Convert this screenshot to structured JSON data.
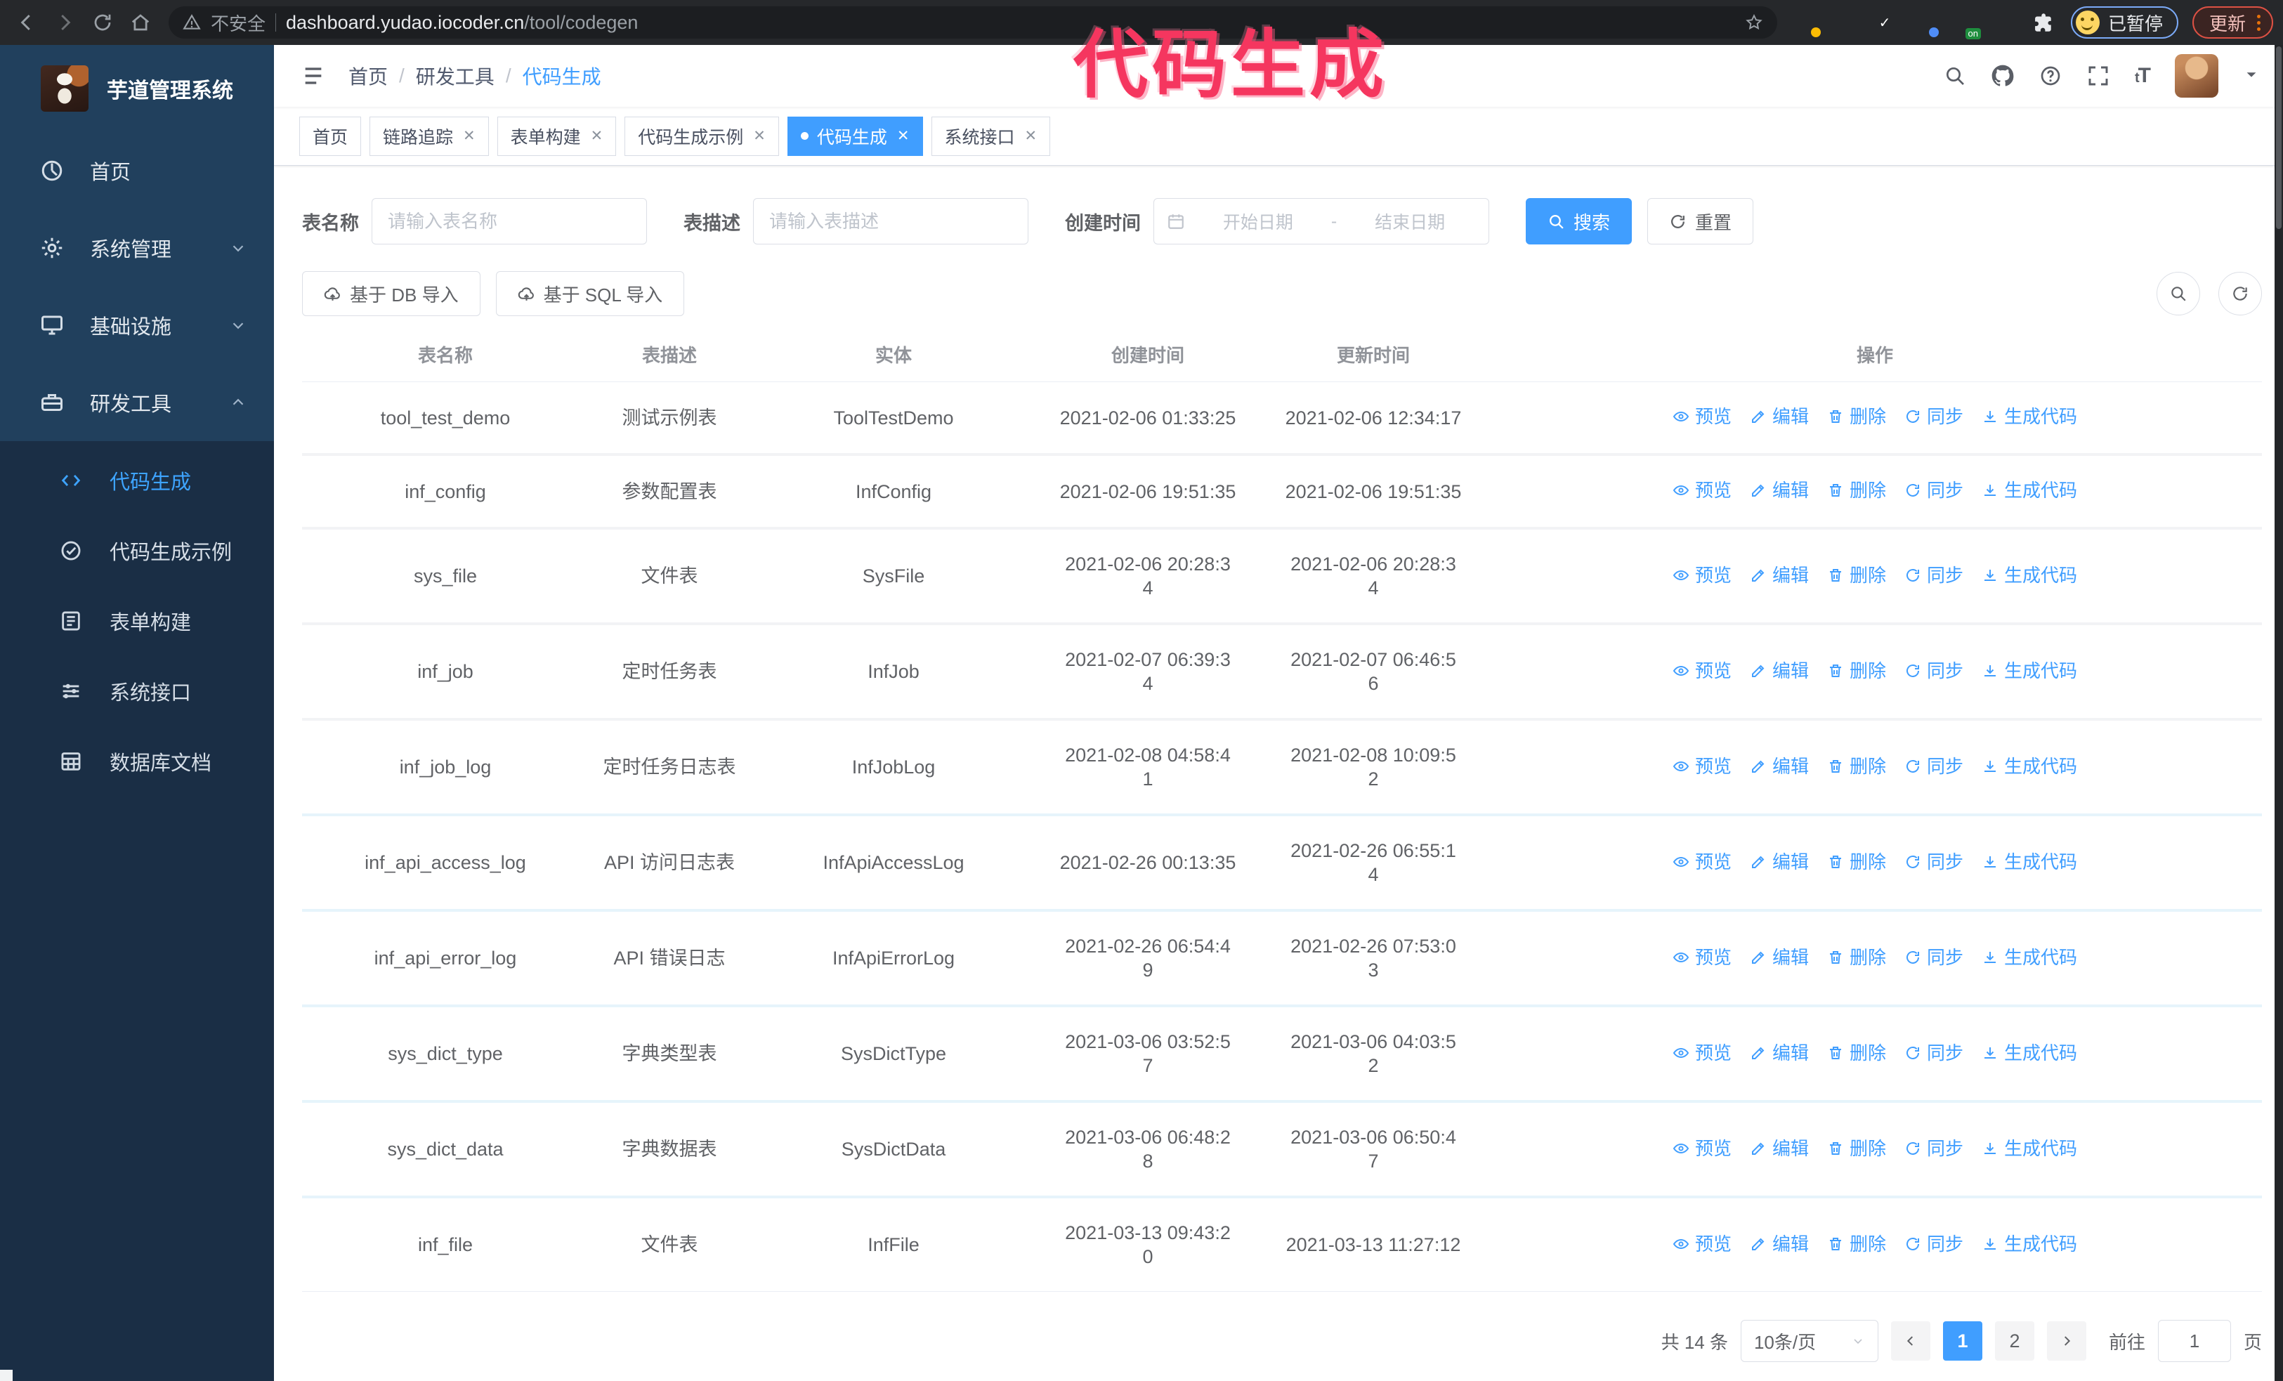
{
  "watermark": "代码生成",
  "browser": {
    "security_label": "不安全",
    "url_host": "dashboard.yudao.iocoder.cn",
    "url_path": "/tool/codegen",
    "profile_label": "已暂停",
    "update_label": "更新",
    "extensions": [
      {
        "name": "extension-orange-icon",
        "bg": "#e8710a",
        "shape": "circle",
        "badge": "#fbbc04"
      },
      {
        "name": "extension-gem-icon",
        "bg": "#4f8df7",
        "shape": "diamond"
      },
      {
        "name": "extension-green-check-icon",
        "bg": "#1e8e3e",
        "shape": "circle",
        "glyph": "✓"
      },
      {
        "name": "extension-grid-icon",
        "bg": "#9aa0a6",
        "shape": "square",
        "badge": "#4f8df7"
      },
      {
        "name": "extension-dark-on-icon",
        "bg": "#3c4043",
        "shape": "square",
        "badge_text": "on"
      },
      {
        "name": "extension-green-avatar-icon",
        "bg": "#8bc34a",
        "shape": "circle"
      },
      {
        "name": "extension-puzzle-icon",
        "shape": "puzzle"
      }
    ]
  },
  "sidebar": {
    "logo_title": "芋道管理系统",
    "top_items": [
      {
        "label": "首页",
        "icon": "dashboard-icon",
        "chevron": null,
        "active": false
      },
      {
        "label": "系统管理",
        "icon": "gear-icon",
        "chevron": "down",
        "active": false
      },
      {
        "label": "基础设施",
        "icon": "monitor-icon",
        "chevron": "down",
        "active": false
      },
      {
        "label": "研发工具",
        "icon": "toolbox-icon",
        "chevron": "up",
        "active": false
      }
    ],
    "sub_items": [
      {
        "label": "代码生成",
        "icon": "code-icon",
        "active": true
      },
      {
        "label": "代码生成示例",
        "icon": "example-icon",
        "active": false
      },
      {
        "label": "表单构建",
        "icon": "form-icon",
        "active": false
      },
      {
        "label": "系统接口",
        "icon": "api-icon",
        "active": false
      },
      {
        "label": "数据库文档",
        "icon": "database-icon",
        "active": false
      }
    ]
  },
  "header": {
    "breadcrumb": [
      "首页",
      "研发工具",
      "代码生成"
    ]
  },
  "tabs": [
    {
      "label": "首页",
      "closable": false,
      "active": false
    },
    {
      "label": "链路追踪",
      "closable": true,
      "active": false
    },
    {
      "label": "表单构建",
      "closable": true,
      "active": false
    },
    {
      "label": "代码生成示例",
      "closable": true,
      "active": false
    },
    {
      "label": "代码生成",
      "closable": true,
      "active": true
    },
    {
      "label": "系统接口",
      "closable": true,
      "active": false
    }
  ],
  "search_form": {
    "fields": [
      {
        "label": "表名称",
        "placeholder": "请输入表名称"
      },
      {
        "label": "表描述",
        "placeholder": "请输入表描述"
      },
      {
        "label": "创建时间",
        "start_placeholder": "开始日期",
        "separator": "-",
        "end_placeholder": "结束日期"
      }
    ],
    "search_label": "搜索",
    "reset_label": "重置"
  },
  "toolbar": {
    "import_db_label": "基于 DB 导入",
    "import_sql_label": "基于 SQL 导入"
  },
  "table": {
    "columns": [
      "表名称",
      "表描述",
      "实体",
      "创建时间",
      "更新时间",
      "操作"
    ],
    "ops": [
      {
        "label": "预览",
        "icon": "eye-icon"
      },
      {
        "label": "编辑",
        "icon": "edit-icon"
      },
      {
        "label": "删除",
        "icon": "delete-icon"
      },
      {
        "label": "同步",
        "icon": "sync-icon"
      },
      {
        "label": "生成代码",
        "icon": "download-icon"
      }
    ],
    "rows": [
      {
        "name": "tool_test_demo",
        "desc": "测试示例表",
        "entity": "ToolTestDemo",
        "created": [
          "2021-02-06 01:33:25"
        ],
        "updated": [
          "2021-02-06 12:34:17"
        ]
      },
      {
        "name": "inf_config",
        "desc": "参数配置表",
        "entity": "InfConfig",
        "created": [
          "2021-02-06 19:51:35"
        ],
        "updated": [
          "2021-02-06 19:51:35"
        ]
      },
      {
        "name": "sys_file",
        "desc": "文件表",
        "entity": "SysFile",
        "created": [
          "2021-02-06 20:28:3",
          "4"
        ],
        "updated": [
          "2021-02-06 20:28:3",
          "4"
        ]
      },
      {
        "name": "inf_job",
        "desc": "定时任务表",
        "entity": "InfJob",
        "created": [
          "2021-02-07 06:39:3",
          "4"
        ],
        "updated": [
          "2021-02-07 06:46:5",
          "6"
        ]
      },
      {
        "name": "inf_job_log",
        "desc": "定时任务日志表",
        "entity": "InfJobLog",
        "created": [
          "2021-02-08 04:58:4",
          "1"
        ],
        "updated": [
          "2021-02-08 10:09:5",
          "2"
        ]
      },
      {
        "name": "inf_api_access_log",
        "desc": "API 访问日志表",
        "entity": "InfApiAccessLog",
        "created": [
          "2021-02-26 00:13:35"
        ],
        "updated": [
          "2021-02-26 06:55:1",
          "4"
        ]
      },
      {
        "name": "inf_api_error_log",
        "desc": "API 错误日志",
        "entity": "InfApiErrorLog",
        "created": [
          "2021-02-26 06:54:4",
          "9"
        ],
        "updated": [
          "2021-02-26 07:53:0",
          "3"
        ]
      },
      {
        "name": "sys_dict_type",
        "desc": "字典类型表",
        "entity": "SysDictType",
        "created": [
          "2021-03-06 03:52:5",
          "7"
        ],
        "updated": [
          "2021-03-06 04:03:5",
          "2"
        ]
      },
      {
        "name": "sys_dict_data",
        "desc": "字典数据表",
        "entity": "SysDictData",
        "created": [
          "2021-03-06 06:48:2",
          "8"
        ],
        "updated": [
          "2021-03-06 06:50:4",
          "7"
        ]
      },
      {
        "name": "inf_file",
        "desc": "文件表",
        "entity": "InfFile",
        "created": [
          "2021-03-13 09:43:2",
          "0"
        ],
        "updated": [
          "2021-03-13 11:27:12"
        ]
      }
    ]
  },
  "pagination": {
    "total_label": "共 14 条",
    "page_size": "10条/页",
    "pages": [
      "1",
      "2"
    ],
    "active_page": "1",
    "goto_label": "前往",
    "goto_value": "1",
    "page_label": "页"
  },
  "colors": {
    "primary": "#409eff",
    "sidebar_bg": "#21405d",
    "submenu_bg": "#1a2e45",
    "watermark": "#f5365f",
    "chrome_bar": "#26282b"
  }
}
